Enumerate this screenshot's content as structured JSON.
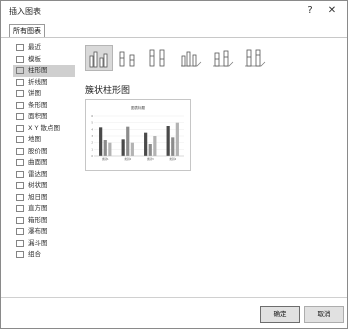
{
  "dialog": {
    "title": "插入图表",
    "help_glyph": "?",
    "close_glyph": "✕",
    "tab_label": "所有图表"
  },
  "sidebar": {
    "items": [
      {
        "label": "最近",
        "icon": "recent-icon"
      },
      {
        "label": "模板",
        "icon": "template-icon"
      },
      {
        "label": "柱形图",
        "icon": "column-chart-icon",
        "selected": true
      },
      {
        "label": "折线图",
        "icon": "line-chart-icon"
      },
      {
        "label": "饼图",
        "icon": "pie-chart-icon"
      },
      {
        "label": "条形图",
        "icon": "bar-chart-icon"
      },
      {
        "label": "面积图",
        "icon": "area-chart-icon"
      },
      {
        "label": "X Y 散点图",
        "icon": "scatter-chart-icon"
      },
      {
        "label": "地图",
        "icon": "map-chart-icon"
      },
      {
        "label": "股价图",
        "icon": "stock-chart-icon"
      },
      {
        "label": "曲面图",
        "icon": "surface-chart-icon"
      },
      {
        "label": "雷达图",
        "icon": "radar-chart-icon"
      },
      {
        "label": "树状图",
        "icon": "treemap-icon"
      },
      {
        "label": "旭日图",
        "icon": "sunburst-icon"
      },
      {
        "label": "直方图",
        "icon": "histogram-icon"
      },
      {
        "label": "箱形图",
        "icon": "box-whisker-icon"
      },
      {
        "label": "瀑布图",
        "icon": "waterfall-icon"
      },
      {
        "label": "漏斗图",
        "icon": "funnel-icon"
      },
      {
        "label": "组合",
        "icon": "combo-chart-icon"
      }
    ]
  },
  "subtypes": [
    {
      "icon": "clustered-column-icon",
      "selected": true
    },
    {
      "icon": "stacked-column-icon"
    },
    {
      "icon": "percent-stacked-column-icon"
    },
    {
      "icon": "3d-clustered-column-icon"
    },
    {
      "icon": "3d-stacked-column-icon"
    },
    {
      "icon": "3d-percent-stacked-column-icon"
    }
  ],
  "main": {
    "heading": "簇状柱形图"
  },
  "chart_data": {
    "type": "bar",
    "title": "图表标题",
    "categories": [
      "类别1",
      "类别2",
      "类别3",
      "类别4"
    ],
    "series": [
      {
        "values": [
          4.3,
          2.5,
          3.5,
          4.5
        ]
      },
      {
        "values": [
          2.4,
          4.4,
          1.8,
          2.8
        ]
      },
      {
        "values": [
          2.0,
          2.0,
          3.0,
          5.0
        ]
      }
    ],
    "ylim": [
      0,
      6
    ],
    "colors": [
      "#4a4a4a",
      "#8c8c8c",
      "#b3b3b3"
    ],
    "grid": true
  },
  "footer": {
    "ok_label": "确定",
    "cancel_label": "取消"
  }
}
